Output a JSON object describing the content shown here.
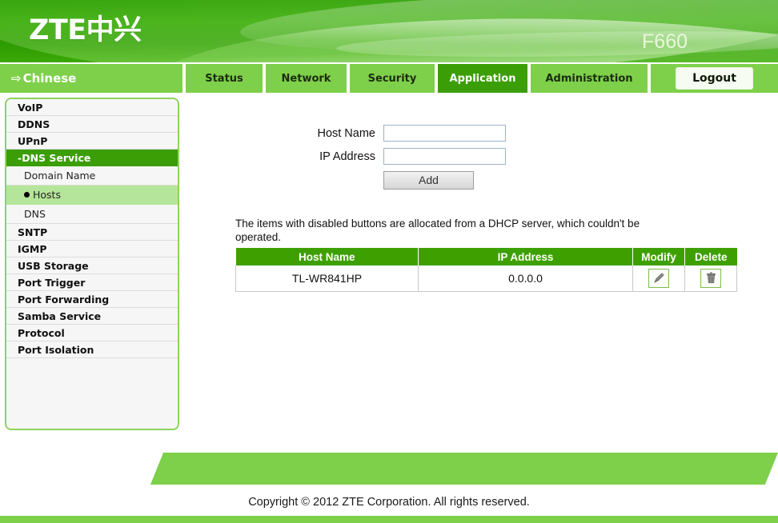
{
  "header": {
    "logo": "ZTE中兴",
    "model": "F660"
  },
  "nav": {
    "language_label": "Chinese",
    "language_arrow": "⇨",
    "tabs": [
      {
        "label": "Status",
        "active": false
      },
      {
        "label": "Network",
        "active": false
      },
      {
        "label": "Security",
        "active": false
      },
      {
        "label": "Application",
        "active": true
      },
      {
        "label": "Administration",
        "active": false
      }
    ],
    "logout_label": "Logout"
  },
  "sidebar": {
    "items": [
      {
        "label": "VoIP",
        "type": "top"
      },
      {
        "label": "DDNS",
        "type": "top"
      },
      {
        "label": "UPnP",
        "type": "top"
      },
      {
        "label": "-DNS Service",
        "type": "group-active"
      },
      {
        "label": "Domain Name",
        "type": "sub"
      },
      {
        "label": "Hosts",
        "type": "sub-selected"
      },
      {
        "label": "DNS",
        "type": "sub"
      },
      {
        "label": "SNTP",
        "type": "top"
      },
      {
        "label": "IGMP",
        "type": "top"
      },
      {
        "label": "USB Storage",
        "type": "top"
      },
      {
        "label": "Port Trigger",
        "type": "top"
      },
      {
        "label": "Port Forwarding",
        "type": "top"
      },
      {
        "label": "Samba Service",
        "type": "top"
      },
      {
        "label": "Protocol",
        "type": "top"
      },
      {
        "label": "Port Isolation",
        "type": "top"
      }
    ]
  },
  "form": {
    "host_name_label": "Host Name",
    "host_name_value": "",
    "host_name_placeholder": "",
    "ip_address_label": "IP Address",
    "ip_address_value": "",
    "ip_address_placeholder": "",
    "add_label": "Add"
  },
  "notice": "The items with disabled buttons are allocated from a DHCP server, which couldn't be operated.",
  "table": {
    "columns": [
      "Host Name",
      "IP Address",
      "Modify",
      "Delete"
    ],
    "rows": [
      {
        "host_name": "TL-WR841HP",
        "ip_address": "0.0.0.0",
        "modify_icon": "pencil-icon",
        "delete_icon": "trash-icon"
      }
    ]
  },
  "footer": {
    "copyright": "Copyright © 2012 ZTE Corporation. All rights reserved."
  },
  "colors": {
    "header_green": "#2fa005",
    "tab_light_green": "#7ed04a",
    "tab_active_green": "#3b9e06",
    "table_header_green": "#3ea000",
    "selected_row_green": "#b5e59a"
  }
}
